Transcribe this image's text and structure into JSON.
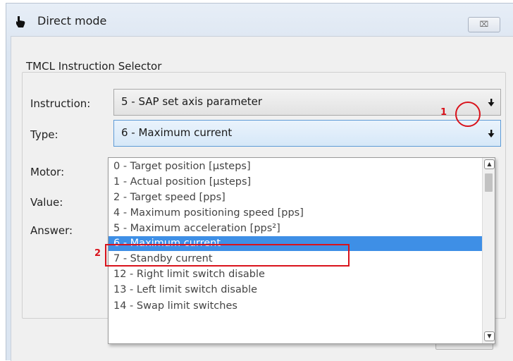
{
  "window": {
    "title": "Direct mode",
    "close_glyph": "⌧"
  },
  "group": {
    "title": "TMCL Instruction Selector"
  },
  "fields": {
    "instruction_label": "Instruction:",
    "instruction_value": "5 - SAP set axis parameter",
    "type_label": "Type:",
    "type_value": "6 - Maximum current",
    "motor_label": "Motor:",
    "value_label": "Value:",
    "answer_label": "Answer:"
  },
  "dropdown": {
    "items": [
      "0 - Target position [µsteps]",
      "1 - Actual position [µsteps]",
      "2 - Target speed [pps]",
      "4 - Maximum positioning speed [pps]",
      "5 - Maximum acceleration [pps²]",
      "6 - Maximum current",
      "7 - Standby current",
      "12 - Right limit switch disable",
      "13 - Left limit switch disable",
      "14 - Swap limit switches"
    ],
    "selected_index": 5,
    "scroll_up_glyph": "▲",
    "scroll_down_glyph": "▼"
  },
  "annotations": {
    "marker_1": "1",
    "marker_2": "2",
    "color": "#d9121b"
  },
  "colors": {
    "selection": "#3e8fe6",
    "window_frame": "#dbe5f1"
  }
}
